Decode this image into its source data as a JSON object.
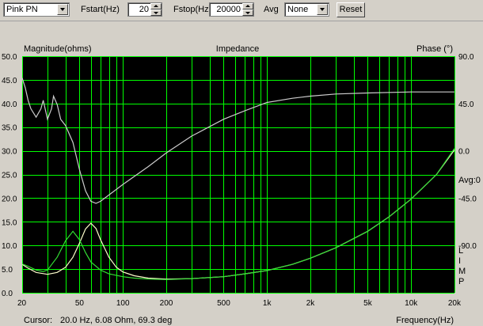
{
  "toolbar": {
    "signal": "Pink PN",
    "fstart_label": "Fstart(Hz)",
    "fstart_value": "20",
    "fstop_label": "Fstop(Hz)",
    "fstop_value": "20000",
    "avg_label": "Avg",
    "avg_value": "None",
    "reset_label": "Reset"
  },
  "status": {
    "cursor_label": "Cursor:",
    "cursor_value": "20.0 Hz, 6.08 Ohm, 69.3 deg",
    "avg_indicator": "Avg:0",
    "side_letters": [
      "L",
      "I",
      "M",
      "P"
    ]
  },
  "colors": {
    "background": "#000000",
    "grid": "#00ff00",
    "magnitude": "#ffffcc",
    "phase": "#cccccc",
    "green_trace": "#33dd33",
    "panel": "#d4d0c8"
  },
  "chart_data": {
    "type": "line",
    "title": "Impedance",
    "xlabel": "Frequency(Hz)",
    "ylabel": "Magnitude(ohms)",
    "y2label": "Phase (°)",
    "x_scale": "log",
    "xlim": [
      20,
      20000
    ],
    "ylim": [
      0,
      50
    ],
    "y2lim": [
      -135,
      90
    ],
    "grid": true,
    "x_ticks": [
      20,
      50,
      100,
      200,
      500,
      1000,
      2000,
      5000,
      10000,
      20000
    ],
    "x_tick_labels": [
      "20",
      "50",
      "100",
      "200",
      "500",
      "1k",
      "2k",
      "5k",
      "10k",
      "20k"
    ],
    "y_ticks": [
      0,
      5,
      10,
      15,
      20,
      25,
      30,
      35,
      40,
      45,
      50
    ],
    "y_tick_labels": [
      "0.0",
      "5.0",
      "10.0",
      "15.0",
      "20.0",
      "25.0",
      "30.0",
      "35.0",
      "40.0",
      "45.0",
      "50.0"
    ],
    "y2_ticks": [
      90,
      45,
      0,
      -45,
      -90
    ],
    "y2_tick_labels": [
      "90.0",
      "45.0",
      "0.0",
      "-45.0",
      "-90.0"
    ],
    "series": [
      {
        "axis": "left",
        "color": "#ffffcc",
        "x": [
          20,
          22,
          25,
          30,
          35,
          40,
          45,
          50,
          55,
          60,
          65,
          70,
          80,
          90,
          100,
          120,
          150,
          200,
          300,
          500,
          700,
          1000,
          1500,
          2000,
          3000,
          5000,
          7000,
          10000,
          15000,
          20000
        ],
        "y": [
          6.0,
          5.2,
          4.3,
          3.9,
          4.3,
          5.4,
          7.5,
          10.5,
          13.5,
          14.7,
          13.6,
          11.2,
          7.5,
          5.4,
          4.4,
          3.6,
          3.1,
          2.9,
          3.0,
          3.4,
          4.0,
          4.7,
          6.0,
          7.3,
          9.5,
          13.0,
          16.0,
          19.8,
          25.0,
          30.2
        ]
      },
      {
        "axis": "left",
        "color": "#33dd33",
        "x": [
          20,
          22,
          25,
          28,
          30,
          35,
          40,
          45,
          50,
          55,
          60,
          70,
          80,
          100,
          120,
          150,
          200,
          300,
          500,
          700,
          1000,
          1500,
          2000,
          3000,
          5000,
          7000,
          10000,
          15000,
          20000
        ],
        "y": [
          6.1,
          5.6,
          4.8,
          4.5,
          4.8,
          7.5,
          11.0,
          13.0,
          11.2,
          8.5,
          6.5,
          4.8,
          4.0,
          3.4,
          3.1,
          2.9,
          2.8,
          3.0,
          3.4,
          4.0,
          4.7,
          6.0,
          7.3,
          9.5,
          13.0,
          16.0,
          19.8,
          25.0,
          30.5
        ]
      },
      {
        "axis": "right",
        "color": "#cccccc",
        "x": [
          20,
          21,
          22,
          23,
          25,
          27,
          28,
          30,
          32,
          33,
          35,
          37,
          40,
          45,
          50,
          55,
          60,
          65,
          70,
          80,
          100,
          150,
          200,
          300,
          500,
          700,
          1000,
          1500,
          2000,
          3000,
          5000,
          10000,
          20000
        ],
        "y": [
          69.3,
          60,
          48,
          40,
          32,
          40,
          48,
          30,
          40,
          52,
          44,
          30,
          24,
          8,
          -18,
          -38,
          -48,
          -50,
          -48,
          -42,
          -32,
          -15,
          -2,
          14,
          30,
          38,
          46,
          50,
          52,
          54,
          55,
          56,
          56
        ]
      }
    ]
  }
}
